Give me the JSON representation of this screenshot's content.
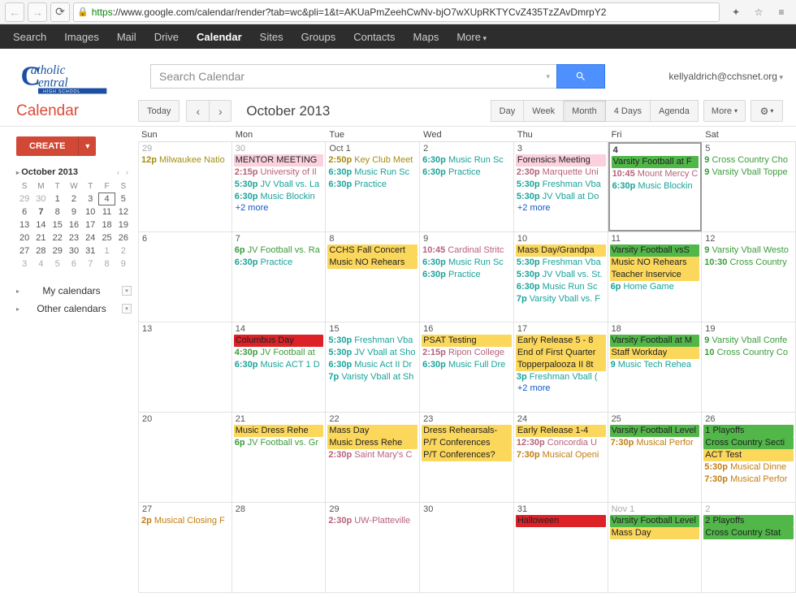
{
  "browser": {
    "url_https": "https",
    "url_rest": "://www.google.com/calendar/render?tab=wc&pli=1&t=AKUaPmZeehCwNv-bjO7wXUpRKTYCvZ435TzZAvDmrpY2"
  },
  "gbar": {
    "search": "Search",
    "images": "Images",
    "mail": "Mail",
    "drive": "Drive",
    "calendar": "Calendar",
    "sites": "Sites",
    "groups": "Groups",
    "contacts": "Contacts",
    "maps": "Maps",
    "more": "More"
  },
  "header": {
    "search_placeholder": "Search Calendar",
    "user_email": "kellyaldrich@cchsnet.org"
  },
  "subbar": {
    "app_title": "Calendar",
    "today": "Today",
    "month_label": "October 2013",
    "views": {
      "day": "Day",
      "week": "Week",
      "month": "Month",
      "days4": "4 Days",
      "agenda": "Agenda"
    },
    "more": "More"
  },
  "sidebar": {
    "create": "CREATE",
    "mini_month": "October 2013",
    "mini_dow": [
      "S",
      "M",
      "T",
      "W",
      "T",
      "F",
      "S"
    ],
    "mini_days": [
      {
        "n": "29",
        "off": true
      },
      {
        "n": "30",
        "off": true
      },
      {
        "n": "1"
      },
      {
        "n": "2"
      },
      {
        "n": "3"
      },
      {
        "n": "4",
        "today": true
      },
      {
        "n": "5"
      },
      {
        "n": "6"
      },
      {
        "n": "7",
        "bold": true
      },
      {
        "n": "8"
      },
      {
        "n": "9"
      },
      {
        "n": "10"
      },
      {
        "n": "11"
      },
      {
        "n": "12"
      },
      {
        "n": "13"
      },
      {
        "n": "14"
      },
      {
        "n": "15"
      },
      {
        "n": "16"
      },
      {
        "n": "17"
      },
      {
        "n": "18"
      },
      {
        "n": "19"
      },
      {
        "n": "20"
      },
      {
        "n": "21"
      },
      {
        "n": "22"
      },
      {
        "n": "23"
      },
      {
        "n": "24"
      },
      {
        "n": "25"
      },
      {
        "n": "26"
      },
      {
        "n": "27"
      },
      {
        "n": "28"
      },
      {
        "n": "29"
      },
      {
        "n": "30"
      },
      {
        "n": "31"
      },
      {
        "n": "1",
        "off": true
      },
      {
        "n": "2",
        "off": true
      },
      {
        "n": "3",
        "off": true
      },
      {
        "n": "4",
        "off": true
      },
      {
        "n": "5",
        "off": true
      },
      {
        "n": "6",
        "off": true
      },
      {
        "n": "7",
        "off": true
      },
      {
        "n": "8",
        "off": true
      },
      {
        "n": "9",
        "off": true
      }
    ],
    "my_calendars": "My calendars",
    "other_calendars": "Other calendars"
  },
  "dayhead": [
    "Sun",
    "Mon",
    "Tue",
    "Wed",
    "Thu",
    "Fri",
    "Sat"
  ],
  "cells": [
    {
      "date": "29",
      "off": true,
      "events": [
        {
          "t": "12p",
          "txt": "Milwaukee Natio",
          "c": "c-olive"
        }
      ]
    },
    {
      "date": "30",
      "off": true,
      "events": [
        {
          "chip": true,
          "txt": "MENTOR MEETING",
          "c": "c-pink-bg"
        },
        {
          "t": "2:15p",
          "txt": "University of Il",
          "c": "c-rose"
        },
        {
          "t": "5:30p",
          "txt": "JV Vball vs. La",
          "c": "c-teal"
        },
        {
          "t": "6:30p",
          "txt": "Music Blockin",
          "c": "c-teal"
        }
      ],
      "more": "+2 more"
    },
    {
      "date": "Oct 1",
      "events": [
        {
          "t": "2:50p",
          "txt": "Key Club Meet",
          "c": "c-olive"
        },
        {
          "t": "6:30p",
          "txt": "Music Run Sc",
          "c": "c-teal"
        },
        {
          "t": "6:30p",
          "txt": "Practice",
          "c": "c-teal"
        }
      ]
    },
    {
      "date": "2",
      "events": [
        {
          "t": "6:30p",
          "txt": "Music Run Sc",
          "c": "c-teal"
        },
        {
          "t": "6:30p",
          "txt": "Practice",
          "c": "c-teal"
        }
      ]
    },
    {
      "date": "3",
      "events": [
        {
          "chip": true,
          "txt": "Forensics Meeting",
          "c": "c-pink-bg"
        },
        {
          "t": "2:30p",
          "txt": "Marquette Uni",
          "c": "c-rose"
        },
        {
          "t": "5:30p",
          "txt": "Freshman Vba",
          "c": "c-teal"
        },
        {
          "t": "5:30p",
          "txt": "JV Vball at Do",
          "c": "c-teal"
        }
      ],
      "more": "+2 more"
    },
    {
      "date": "4",
      "today": true,
      "events": [
        {
          "chip": true,
          "txt": "Varsity Football at F",
          "c": "c-green-bg"
        },
        {
          "t": "10:45",
          "txt": "Mount Mercy C",
          "c": "c-rose"
        },
        {
          "t": "6:30p",
          "txt": "Music Blockin",
          "c": "c-teal"
        }
      ]
    },
    {
      "date": "5",
      "events": [
        {
          "t": "9",
          "txt": "Cross Country Cho",
          "c": "c-green"
        },
        {
          "t": "9",
          "txt": "Varsity Vball Toppe",
          "c": "c-green"
        }
      ]
    },
    {
      "date": "6",
      "events": []
    },
    {
      "date": "7",
      "events": [
        {
          "t": "6p",
          "txt": "JV Football vs. Ra",
          "c": "c-green"
        },
        {
          "t": "6:30p",
          "txt": "Practice",
          "c": "c-teal"
        }
      ]
    },
    {
      "date": "8",
      "events": [
        {
          "chip": true,
          "txt": "CCHS Fall Concert",
          "c": "c-yellow-bg"
        },
        {
          "chip": true,
          "txt": "Music NO Rehears",
          "c": "c-yellow-bg"
        }
      ]
    },
    {
      "date": "9",
      "events": [
        {
          "t": "10:45",
          "txt": "Cardinal Stritc",
          "c": "c-rose"
        },
        {
          "t": "6:30p",
          "txt": "Music Run Sc",
          "c": "c-teal"
        },
        {
          "t": "6:30p",
          "txt": "Practice",
          "c": "c-teal"
        }
      ]
    },
    {
      "date": "10",
      "events": [
        {
          "chip": true,
          "txt": "Mass Day/Grandpa",
          "c": "c-yellow-bg"
        },
        {
          "t": "5:30p",
          "txt": "Freshman Vba",
          "c": "c-teal"
        },
        {
          "t": "5:30p",
          "txt": "JV Vball vs. St.",
          "c": "c-teal"
        },
        {
          "t": "6:30p",
          "txt": "Music Run Sc",
          "c": "c-teal"
        },
        {
          "t": "7p",
          "txt": "Varsity Vball vs. F",
          "c": "c-teal"
        }
      ]
    },
    {
      "date": "11",
      "events": [
        {
          "chip": true,
          "txt": "Varsity Football vsS",
          "c": "c-green-bg"
        },
        {
          "chip": true,
          "txt": "Music NO Rehears",
          "c": "c-yellow-bg"
        },
        {
          "chip": true,
          "txt": "Teacher Inservice",
          "c": "c-yellow-bg"
        },
        {
          "t": "6p",
          "txt": "Home Game",
          "c": "c-teal"
        }
      ]
    },
    {
      "date": "12",
      "events": [
        {
          "t": "9",
          "txt": "Varsity Vball Westo",
          "c": "c-green"
        },
        {
          "t": "10:30",
          "txt": "Cross Country",
          "c": "c-green"
        }
      ]
    },
    {
      "date": "13",
      "events": []
    },
    {
      "date": "14",
      "events": [
        {
          "chip": true,
          "txt": "Columbus Day",
          "c": "c-red-bg"
        },
        {
          "t": "4:30p",
          "txt": "JV Football at",
          "c": "c-green"
        },
        {
          "t": "6:30p",
          "txt": "Music ACT 1 D",
          "c": "c-teal"
        }
      ]
    },
    {
      "date": "15",
      "events": [
        {
          "t": "5:30p",
          "txt": "Freshman Vba",
          "c": "c-teal"
        },
        {
          "t": "5:30p",
          "txt": "JV Vball at Sho",
          "c": "c-teal"
        },
        {
          "t": "6:30p",
          "txt": "Music Act II Dr",
          "c": "c-teal"
        },
        {
          "t": "7p",
          "txt": "Varisty Vball at Sh",
          "c": "c-teal"
        }
      ]
    },
    {
      "date": "16",
      "events": [
        {
          "chip": true,
          "txt": "PSAT Testing",
          "c": "c-yellow-bg"
        },
        {
          "t": "2:15p",
          "txt": "Ripon College",
          "c": "c-rose"
        },
        {
          "t": "6:30p",
          "txt": "Music Full Dre",
          "c": "c-teal"
        }
      ]
    },
    {
      "date": "17",
      "events": [
        {
          "chip": true,
          "txt": "Early Release 5 - 8",
          "c": "c-yellow-bg"
        },
        {
          "chip": true,
          "txt": "End of First Quarter",
          "c": "c-yellow-bg"
        },
        {
          "chip": true,
          "txt": "Topperpalooza II 8t",
          "c": "c-yellow-bg"
        },
        {
          "t": "3p",
          "txt": "Freshman Vball (",
          "c": "c-teal"
        }
      ],
      "more": "+2 more"
    },
    {
      "date": "18",
      "events": [
        {
          "chip": true,
          "txt": "Varsity Football at M",
          "c": "c-green-bg"
        },
        {
          "chip": true,
          "txt": "Staff Workday",
          "c": "c-yellow-bg"
        },
        {
          "t": "9",
          "txt": "Music Tech Rehea",
          "c": "c-teal"
        }
      ]
    },
    {
      "date": "19",
      "events": [
        {
          "t": "9",
          "txt": "Varsity Vball Confe",
          "c": "c-green"
        },
        {
          "t": "10",
          "txt": "Cross Country Co",
          "c": "c-green"
        }
      ]
    },
    {
      "date": "20",
      "events": []
    },
    {
      "date": "21",
      "events": [
        {
          "chip": true,
          "txt": "Music Dress Rehe",
          "c": "c-yellow-bg"
        },
        {
          "t": "6p",
          "txt": "JV Football vs. Gr",
          "c": "c-green"
        }
      ]
    },
    {
      "date": "22",
      "events": [
        {
          "chip": true,
          "txt": "Mass Day",
          "c": "c-yellow-bg"
        },
        {
          "chip": true,
          "txt": "Music Dress Rehe",
          "c": "c-yellow-bg"
        },
        {
          "t": "2:30p",
          "txt": "Saint Mary's C",
          "c": "c-rose"
        }
      ]
    },
    {
      "date": "23",
      "events": [
        {
          "chip": true,
          "txt": "Dress Rehearsals-",
          "c": "c-yellow-bg"
        },
        {
          "chip": true,
          "txt": "P/T Conferences",
          "c": "c-yellow-bg"
        },
        {
          "chip": true,
          "txt": "P/T Conferences?",
          "c": "c-yellow-bg"
        }
      ]
    },
    {
      "date": "24",
      "events": [
        {
          "chip": true,
          "txt": "Early Release 1-4",
          "c": "c-yellow-bg"
        },
        {
          "t": "12:30p",
          "txt": "Concordia U",
          "c": "c-rose"
        },
        {
          "t": "7:30p",
          "txt": "Musical Openi",
          "c": "c-orange"
        }
      ]
    },
    {
      "date": "25",
      "events": [
        {
          "chip": true,
          "txt": "Varsity Football Level",
          "c": "c-green-bg"
        },
        {
          "t": "7:30p",
          "txt": "Musical Perfor",
          "c": "c-orange"
        }
      ]
    },
    {
      "date": "26",
      "events": [
        {
          "chip": true,
          "txt": "1 Playoffs",
          "c": "c-green-bg"
        },
        {
          "chip": true,
          "txt": "Cross Country Secti",
          "c": "c-green-bg"
        },
        {
          "chip": true,
          "txt": "ACT Test",
          "c": "c-yellow-bg"
        },
        {
          "t": "5:30p",
          "txt": "Musical Dinne",
          "c": "c-orange"
        },
        {
          "t": "7:30p",
          "txt": "Musical Perfor",
          "c": "c-orange"
        }
      ]
    },
    {
      "date": "27",
      "events": [
        {
          "t": "2p",
          "txt": "Musical Closing F",
          "c": "c-orange"
        }
      ]
    },
    {
      "date": "28",
      "events": []
    },
    {
      "date": "29",
      "events": [
        {
          "t": "2:30p",
          "txt": "UW-Platteville",
          "c": "c-rose"
        }
      ]
    },
    {
      "date": "30",
      "events": []
    },
    {
      "date": "31",
      "events": [
        {
          "chip": true,
          "txt": "Halloween",
          "c": "c-red-bg"
        }
      ]
    },
    {
      "date": "Nov 1",
      "off": true,
      "events": [
        {
          "chip": true,
          "txt": "Varsity Football Level",
          "c": "c-green-bg"
        },
        {
          "chip": true,
          "txt": "Mass Day",
          "c": "c-yellow-bg"
        }
      ]
    },
    {
      "date": "2",
      "off": true,
      "events": [
        {
          "chip": true,
          "txt": "2 Playoffs",
          "c": "c-green-bg"
        },
        {
          "chip": true,
          "txt": "Cross Country Stat",
          "c": "c-green-bg"
        }
      ]
    }
  ]
}
